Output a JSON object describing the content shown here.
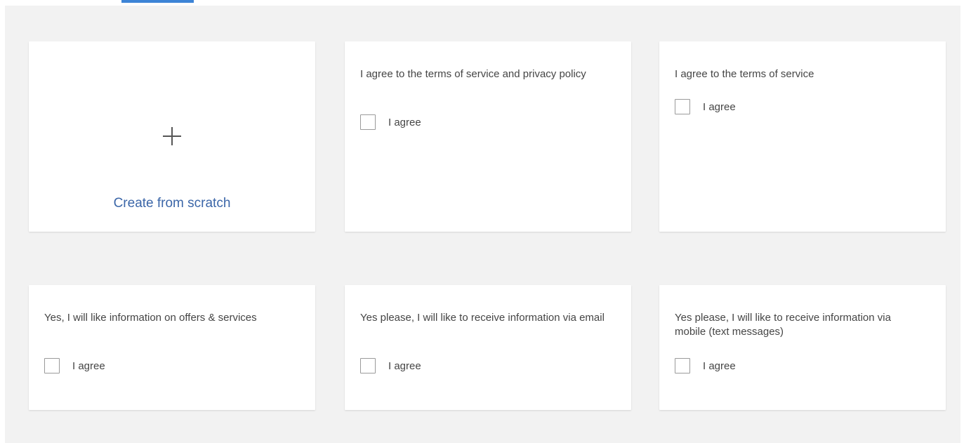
{
  "create_card": {
    "label": "Create from scratch",
    "icon": "plus-icon"
  },
  "templates": [
    {
      "text": "I agree to the terms of service and privacy policy",
      "checkbox_label": "I agree",
      "checked": false
    },
    {
      "text": "I agree to the terms of service",
      "checkbox_label": "I agree",
      "checked": false
    },
    {
      "text": "Yes, I will like information on offers & services",
      "checkbox_label": "I agree",
      "checked": false
    },
    {
      "text": "Yes please, I will like to receive information via email",
      "checkbox_label": "I agree",
      "checked": false
    },
    {
      "text": "Yes please, I will like to receive information via mobile (text messages)",
      "checkbox_label": "I agree",
      "checked": false
    }
  ],
  "colors": {
    "accent": "#3d84d6",
    "link": "#3b66a8",
    "panel_background": "#f2f2f2"
  }
}
